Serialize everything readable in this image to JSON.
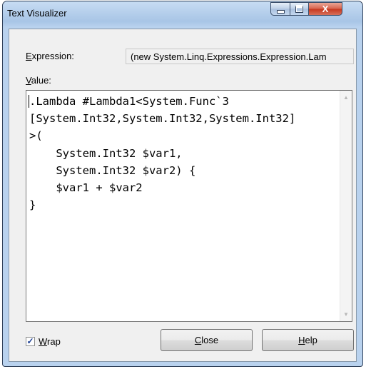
{
  "window": {
    "title": "Text Visualizer",
    "close_glyph": "X"
  },
  "expression": {
    "label": "Expression:",
    "value": "(new System.Linq.Expressions.Expression.Lam"
  },
  "value": {
    "label": "Value:",
    "text": ".Lambda #Lambda1<System.Func`3\n[System.Int32,System.Int32,System.Int32]\n>(\n    System.Int32 $var1,\n    System.Int32 $var2) {\n    $var1 + $var2\n}"
  },
  "wrap": {
    "label": "Wrap",
    "checked": true,
    "check_glyph": "✓"
  },
  "buttons": {
    "close_label": "Close",
    "help_label": "Help"
  },
  "icons": {
    "scroll_up": "▲",
    "scroll_down": "▼"
  }
}
